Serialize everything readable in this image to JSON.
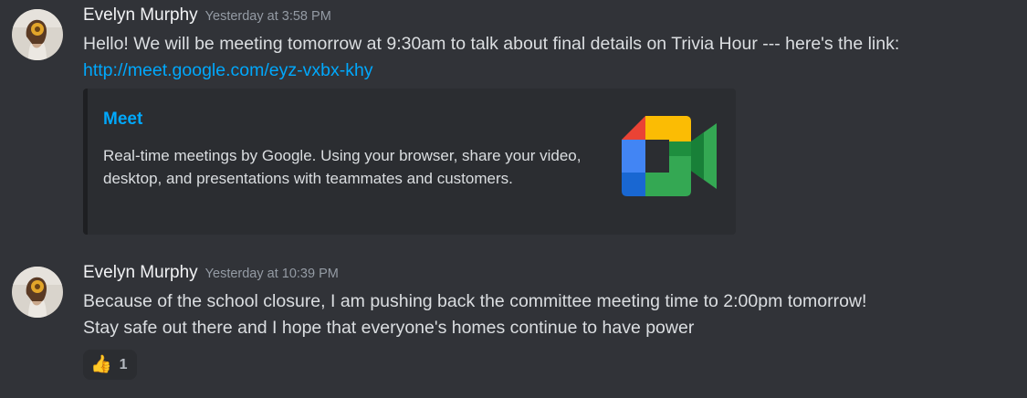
{
  "messages": [
    {
      "author": "Evelyn Murphy",
      "timestamp": "Yesterday at 3:58 PM",
      "text": "Hello! We will be meeting tomorrow at 9:30am to talk about final details on Trivia Hour --- here's the link: ",
      "link": "http://meet.google.com/eyz-vxbx-khy",
      "embed": {
        "title": "Meet",
        "description": "Real-time meetings by Google. Using your browser, share your video, desktop, and presentations with teammates and customers.",
        "thumbnail_icon": "google-meet-logo"
      }
    },
    {
      "author": "Evelyn Murphy",
      "timestamp": "Yesterday at 10:39 PM",
      "lines": [
        "Because of the school closure, I am pushing back the committee meeting time to 2:00pm tomorrow!",
        "Stay safe out there and I hope that everyone's homes continue to have power"
      ],
      "reaction": {
        "emoji": "👍",
        "count": "1"
      }
    }
  ],
  "colors": {
    "background": "#313338",
    "embed_background": "#2b2d31",
    "link": "#00a8fc",
    "username": "#f2f3f5",
    "timestamp": "#949ba4",
    "meet_green": "#34a853",
    "meet_yellow": "#fbbc04",
    "meet_blue": "#4285f4",
    "meet_red": "#ea4335"
  }
}
